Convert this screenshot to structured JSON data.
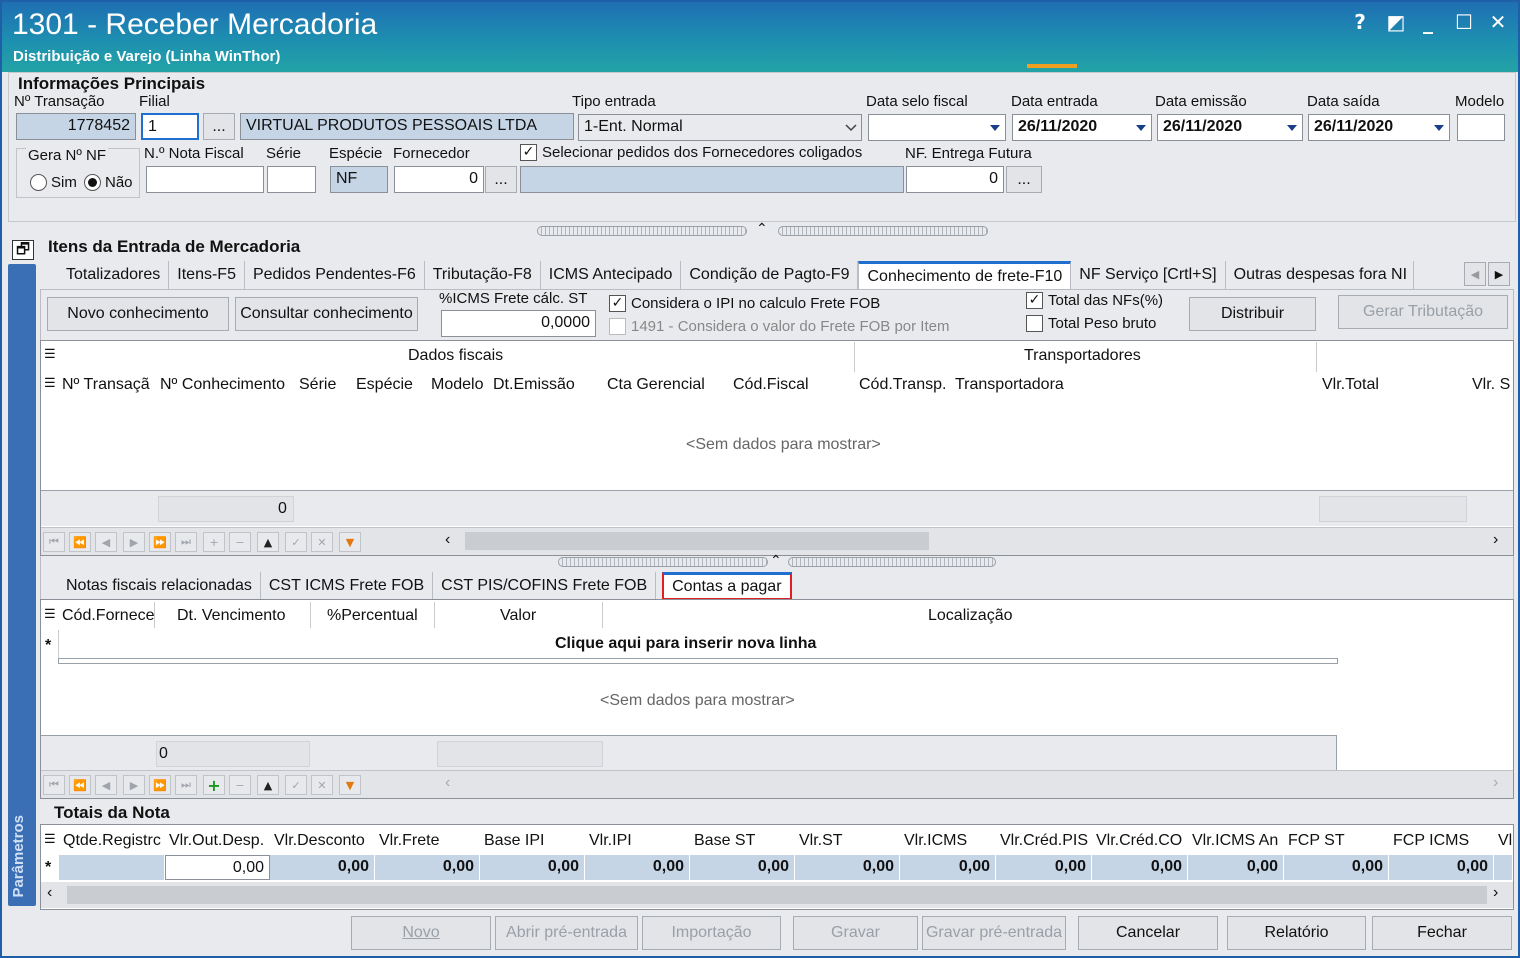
{
  "window": {
    "title": "1301 - Receber Mercadoria",
    "subtitle": "Distribuição e Varejo (Linha WinThor)",
    "help": "?",
    "restore": "◩",
    "minimize": "_",
    "maximize": "☐",
    "close": "✕"
  },
  "info": {
    "section": "Informações Principais",
    "transacao_label": "Nº Transação",
    "transacao": "1778452",
    "filial_label": "Filial",
    "filial": "1",
    "browse": "...",
    "filial_nome": "VIRTUAL PRODUTOS PESSOAIS LTDA",
    "tipo_entrada_label": "Tipo entrada",
    "tipo_entrada": "1-Ent. Normal",
    "data_selo_label": "Data selo fiscal",
    "data_entrada_label": "Data entrada",
    "data_entrada": "26/11/2020",
    "data_emissao_label": "Data emissão",
    "data_emissao": "26/11/2020",
    "data_saida_label": "Data saída",
    "data_saida": "26/11/2020",
    "modelo_label": "Modelo",
    "gera_nf_label": "Gera Nº NF",
    "sim": "Sim",
    "nao": "Não",
    "nota_label": "N.º Nota Fiscal",
    "serie_label": "Série",
    "especie_label": "Espécie",
    "especie": "NF",
    "fornecedor_label": "Fornecedor",
    "fornecedor": "0",
    "coligados": "Selecionar pedidos dos Fornecedores coligados",
    "nf_futura_label": "NF. Entrega Futura",
    "nf_futura": "0"
  },
  "itens": {
    "section": "Itens da Entrada de Mercadoria",
    "tabs": [
      "Totalizadores",
      "Itens-F5",
      "Pedidos Pendentes-F6",
      "Tributação-F8",
      "ICMS Antecipado",
      "Condição de Pagto-F9",
      "Conhecimento de frete-F10",
      "NF Serviço [Crtl+S]",
      "Outras despesas fora NI"
    ],
    "novo_conhecimento": "Novo conhecimento",
    "consultar_conhecimento": "Consultar conhecimento",
    "icms_label": "%ICMS Frete cálc. ST",
    "icms_value": "0,0000",
    "considera_ipi": "Considera o IPI no calculo Frete FOB",
    "considera_1491": "1491 - Considera o valor do Frete FOB por Item",
    "total_nfs": "Total das NFs(%)",
    "total_peso": "Total Peso bruto",
    "distribuir": "Distribuir",
    "gerar_tributacao": "Gerar Tributação",
    "group_fiscais": "Dados fiscais",
    "group_transp": "Transportadores",
    "cols": [
      "Nº Transaçã",
      "Nº Conhecimento",
      "Série",
      "Espécie",
      "Modelo",
      "Dt.Emissão",
      "Cta Gerencial",
      "Cód.Fiscal",
      "Cód.Transp.",
      "Transportadora",
      "Vlr.Total",
      "Vlr. S"
    ],
    "empty": "<Sem dados para mostrar>",
    "footer_value": "0"
  },
  "sub": {
    "tabs": [
      "Notas fiscais relacionadas",
      "CST ICMS Frete FOB",
      "CST PIS/COFINS Frete FOB",
      "Contas a pagar"
    ],
    "cols": [
      "Cód.Fornece",
      "Dt. Vencimento",
      "%Percentual",
      "Valor",
      "Localização"
    ],
    "new_row": "Clique aqui para inserir nova linha",
    "row_marker": "*",
    "empty": "<Sem dados para mostrar>",
    "footer_value": "0"
  },
  "totais": {
    "section": "Totais da Nota",
    "cols": [
      "Qtde.Registrc",
      "Vlr.Out.Desp.",
      "Vlr.Desconto",
      "Vlr.Frete",
      "Base IPI",
      "Vlr.IPI",
      "Base ST",
      "Vlr.ST",
      "Vlr.ICMS",
      "Vlr.Créd.PIS",
      "Vlr.Créd.CO",
      "Vlr.ICMS An",
      "FCP ST",
      "FCP ICMS",
      "Vl"
    ],
    "row_marker": "*",
    "values": [
      "",
      "0,00",
      "0,00",
      "0,00",
      "0,00",
      "0,00",
      "0,00",
      "0,00",
      "0,00",
      "0,00",
      "0,00",
      "0,00",
      "0,00",
      "0,00",
      ""
    ]
  },
  "sidebar": "Parâmetros",
  "buttons": {
    "novo": "Novo",
    "abrir": "Abrir pré-entrada",
    "importacao": "Importação",
    "gravar": "Gravar",
    "gravar_pre": "Gravar pré-entrada",
    "cancelar": "Cancelar",
    "relatorio": "Relatório",
    "fechar": "Fechar"
  },
  "colors": {
    "titlebar": "#1f6fb3",
    "accent": "#1f6fd0",
    "highlight": "#e02020",
    "readonly": "#c6d5e6"
  }
}
